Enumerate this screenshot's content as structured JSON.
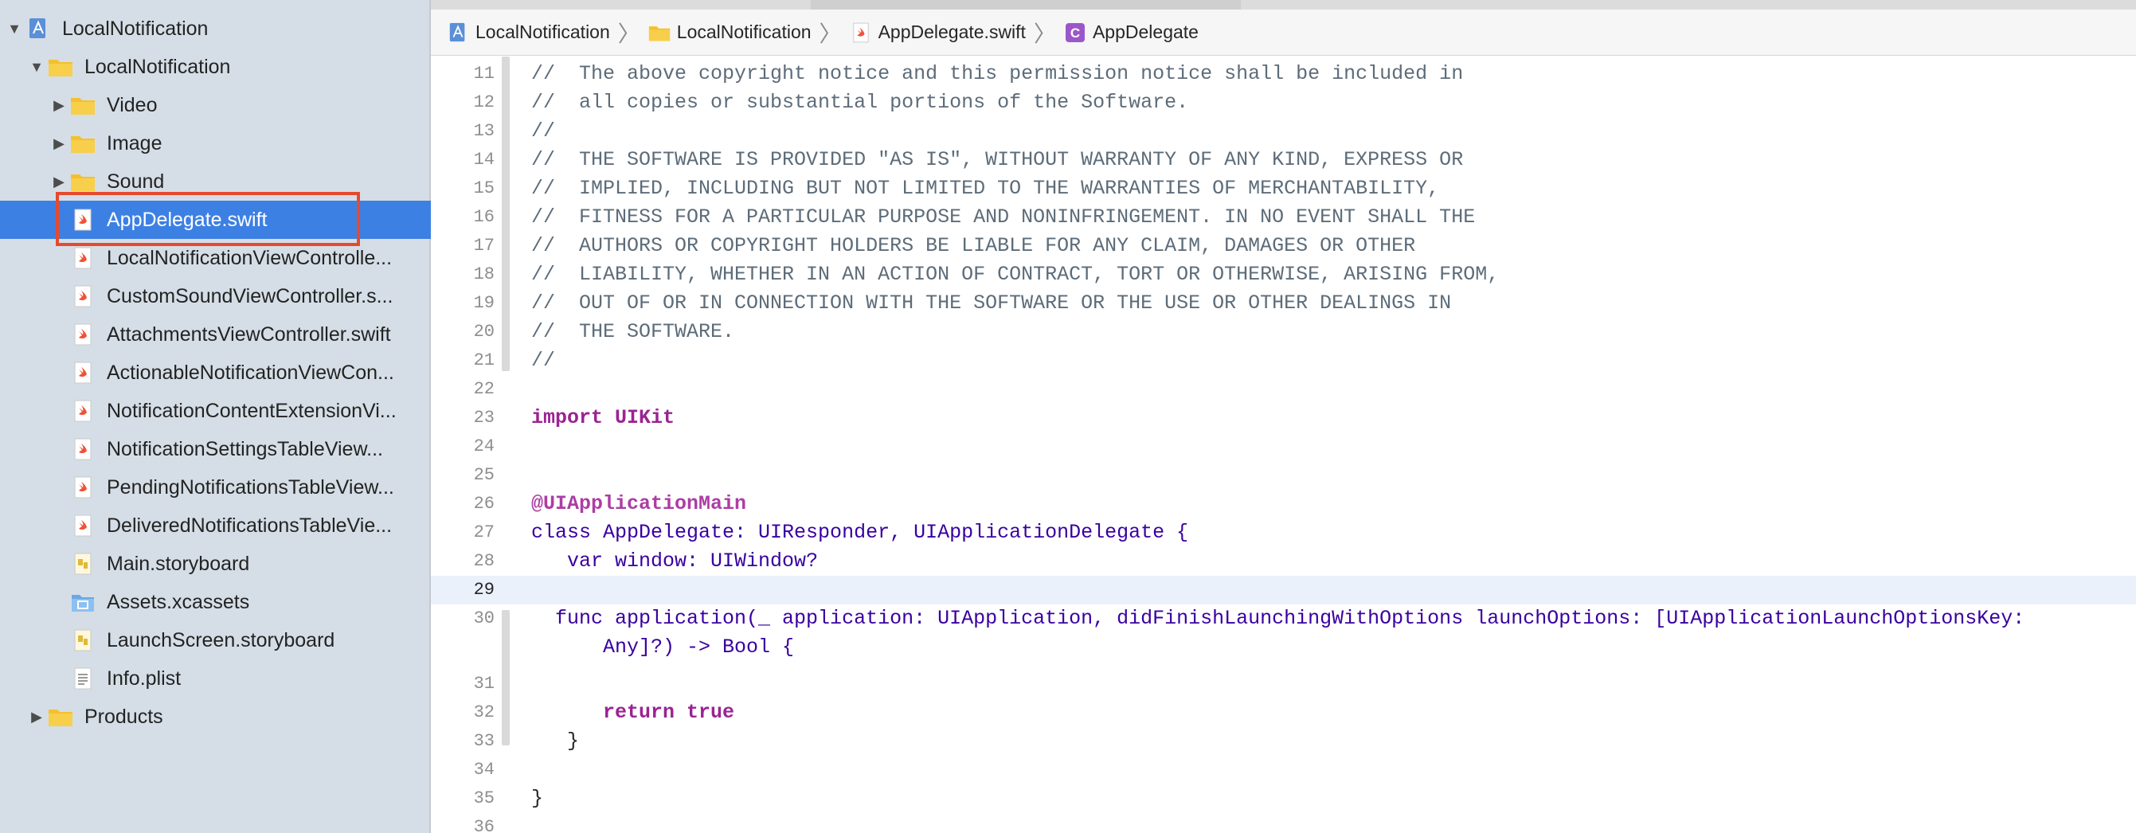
{
  "sidebar": {
    "items": [
      {
        "label": "LocalNotification",
        "icon": "project-icon",
        "expanded": true
      },
      {
        "label": "LocalNotification",
        "icon": "folder-icon",
        "expanded": true
      },
      {
        "label": "Video",
        "icon": "folder-icon",
        "expanded": false
      },
      {
        "label": "Image",
        "icon": "folder-icon",
        "expanded": false
      },
      {
        "label": "Sound",
        "icon": "folder-icon",
        "expanded": false
      },
      {
        "label": "AppDelegate.swift",
        "icon": "swift-file-icon",
        "selected": true
      },
      {
        "label": "LocalNotificationViewControlle...",
        "icon": "swift-file-icon"
      },
      {
        "label": "CustomSoundViewController.s...",
        "icon": "swift-file-icon"
      },
      {
        "label": "AttachmentsViewController.swift",
        "icon": "swift-file-icon"
      },
      {
        "label": "ActionableNotificationViewCon...",
        "icon": "swift-file-icon"
      },
      {
        "label": "NotificationContentExtensionVi...",
        "icon": "swift-file-icon"
      },
      {
        "label": "NotificationSettingsTableView...",
        "icon": "swift-file-icon"
      },
      {
        "label": "PendingNotificationsTableView...",
        "icon": "swift-file-icon"
      },
      {
        "label": "DeliveredNotificationsTableVie...",
        "icon": "swift-file-icon"
      },
      {
        "label": "Main.storyboard",
        "icon": "storyboard-icon"
      },
      {
        "label": "Assets.xcassets",
        "icon": "assets-icon"
      },
      {
        "label": "LaunchScreen.storyboard",
        "icon": "storyboard-icon"
      },
      {
        "label": "Info.plist",
        "icon": "plist-icon"
      },
      {
        "label": "Products",
        "icon": "folder-icon",
        "expanded": false
      }
    ]
  },
  "jumpbar": {
    "crumbs": [
      {
        "label": "LocalNotification",
        "icon": "project-icon"
      },
      {
        "label": "LocalNotification",
        "icon": "folder-icon"
      },
      {
        "label": "AppDelegate.swift",
        "icon": "swift-file-icon"
      },
      {
        "label": "AppDelegate",
        "icon": "class-c-icon"
      }
    ]
  },
  "editor": {
    "lines": [
      {
        "n": "11",
        "text": "//  The above copyright notice and this permission notice shall be included in"
      },
      {
        "n": "12",
        "text": "//  all copies or substantial portions of the Software."
      },
      {
        "n": "13",
        "text": "//"
      },
      {
        "n": "14",
        "text": "//  THE SOFTWARE IS PROVIDED \"AS IS\", WITHOUT WARRANTY OF ANY KIND, EXPRESS OR"
      },
      {
        "n": "15",
        "text": "//  IMPLIED, INCLUDING BUT NOT LIMITED TO THE WARRANTIES OF MERCHANTABILITY,"
      },
      {
        "n": "16",
        "text": "//  FITNESS FOR A PARTICULAR PURPOSE AND NONINFRINGEMENT. IN NO EVENT SHALL THE"
      },
      {
        "n": "17",
        "text": "//  AUTHORS OR COPYRIGHT HOLDERS BE LIABLE FOR ANY CLAIM, DAMAGES OR OTHER"
      },
      {
        "n": "18",
        "text": "//  LIABILITY, WHETHER IN AN ACTION OF CONTRACT, TORT OR OTHERWISE, ARISING FROM,"
      },
      {
        "n": "19",
        "text": "//  OUT OF OR IN CONNECTION WITH THE SOFTWARE OR THE USE OR OTHER DEALINGS IN"
      },
      {
        "n": "20",
        "text": "//  THE SOFTWARE."
      },
      {
        "n": "21",
        "text": "//"
      },
      {
        "n": "22",
        "text": ""
      },
      {
        "n": "23",
        "text": "import UIKit"
      },
      {
        "n": "24",
        "text": ""
      },
      {
        "n": "25",
        "text": ""
      },
      {
        "n": "26",
        "text": "@UIApplicationMain"
      },
      {
        "n": "27",
        "text": "class AppDelegate: UIResponder, UIApplicationDelegate {"
      },
      {
        "n": "28",
        "text": "   var window: UIWindow?"
      },
      {
        "n": "29",
        "text": ""
      },
      {
        "n": "30",
        "text": "  func application(_ application: UIApplication, didFinishLaunchingWithOptions launchOptions: [UIApplicationLaunchOptionsKey:"
      },
      {
        "n": "",
        "text": "      Any]?) -> Bool {"
      },
      {
        "n": "31",
        "text": ""
      },
      {
        "n": "32",
        "text": "      return true"
      },
      {
        "n": "33",
        "text": "   }"
      },
      {
        "n": "34",
        "text": ""
      },
      {
        "n": "35",
        "text": "}"
      },
      {
        "n": "36",
        "text": ""
      }
    ]
  },
  "colors": {
    "selection": "#3d80e4",
    "highlight_box": "#e64a2e",
    "sidebar_bg": "#d5dee6",
    "keyword": "#9b2393",
    "comment": "#5d6c79"
  }
}
